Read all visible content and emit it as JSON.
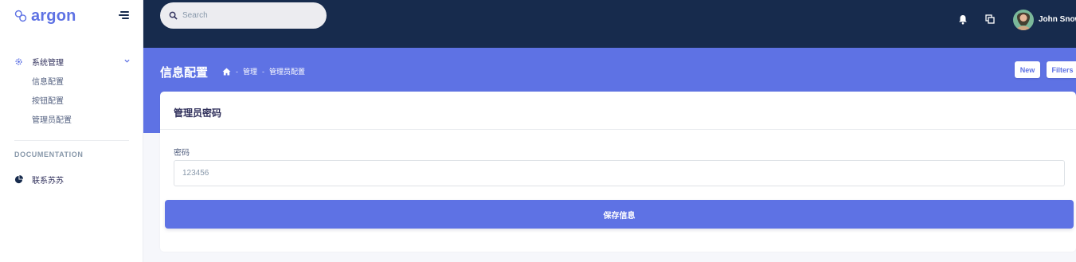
{
  "brand": {
    "name": "argon",
    "color": "#5e72e4"
  },
  "sidebar": {
    "group": {
      "label": "系统管理",
      "icon": "gear-icon",
      "items": [
        {
          "label": "信息配置"
        },
        {
          "label": "按钮配置"
        },
        {
          "label": "管理员配置"
        }
      ]
    },
    "documentation_heading": "DOCUMENTATION",
    "doc_item": {
      "label": "联系苏苏",
      "icon": "pie-chart-icon"
    }
  },
  "topbar": {
    "search_placeholder": "Search",
    "user_name": "John Snow",
    "icons": [
      "bell-icon",
      "multiple-windows-icon"
    ],
    "background": "#172b4d"
  },
  "header": {
    "title": "信息配置",
    "breadcrumb": [
      "管理",
      "管理员配置"
    ],
    "buttons": {
      "new": "New",
      "filters": "Filters"
    },
    "background": "#5e72e4"
  },
  "card": {
    "title": "管理员密码",
    "field_label": "密码",
    "field_value": "123456",
    "submit_label": "保存信息"
  }
}
